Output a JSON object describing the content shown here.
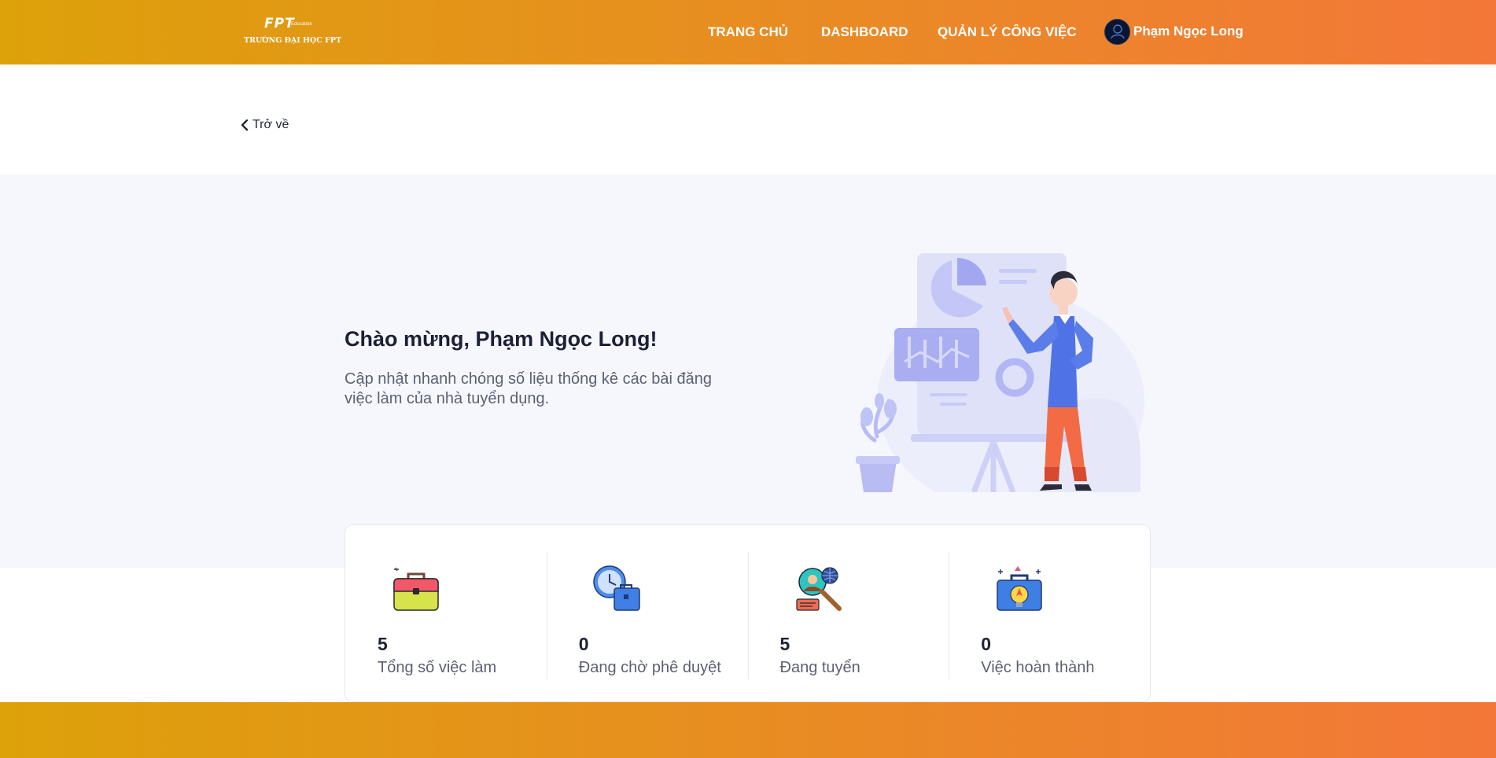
{
  "header": {
    "logo_mark": "FPT",
    "logo_tagline": "Education",
    "logo_school": "TRƯỜNG ĐẠI HỌC FPT",
    "nav": {
      "home": "TRANG CHỦ",
      "dashboard": "DASHBOARD",
      "jobs": "QUẢN LÝ CÔNG VIỆC"
    },
    "user_name": "Phạm Ngọc Long"
  },
  "back_label": "Trở về",
  "hero": {
    "title": "Chào mừng, Phạm Ngọc Long!",
    "description": "Cập nhật nhanh chóng số liệu thống kê các bài đăng việc làm của nhà tuyển dụng."
  },
  "stats": [
    {
      "icon": "briefcase-icon",
      "value": "5",
      "label": "Tổng số việc làm"
    },
    {
      "icon": "clock-briefcase-icon",
      "value": "0",
      "label": "Đang chờ phê duyệt"
    },
    {
      "icon": "candidate-search-icon",
      "value": "5",
      "label": "Đang tuyển"
    },
    {
      "icon": "idea-briefcase-icon",
      "value": "0",
      "label": "Việc hoàn thành"
    }
  ],
  "colors": {
    "header_gradient_start": "#dda10a",
    "header_gradient_end": "#f37739",
    "hero_background": "#f6f7fd",
    "title_text": "#1c2036",
    "muted_text": "#5d6072"
  }
}
